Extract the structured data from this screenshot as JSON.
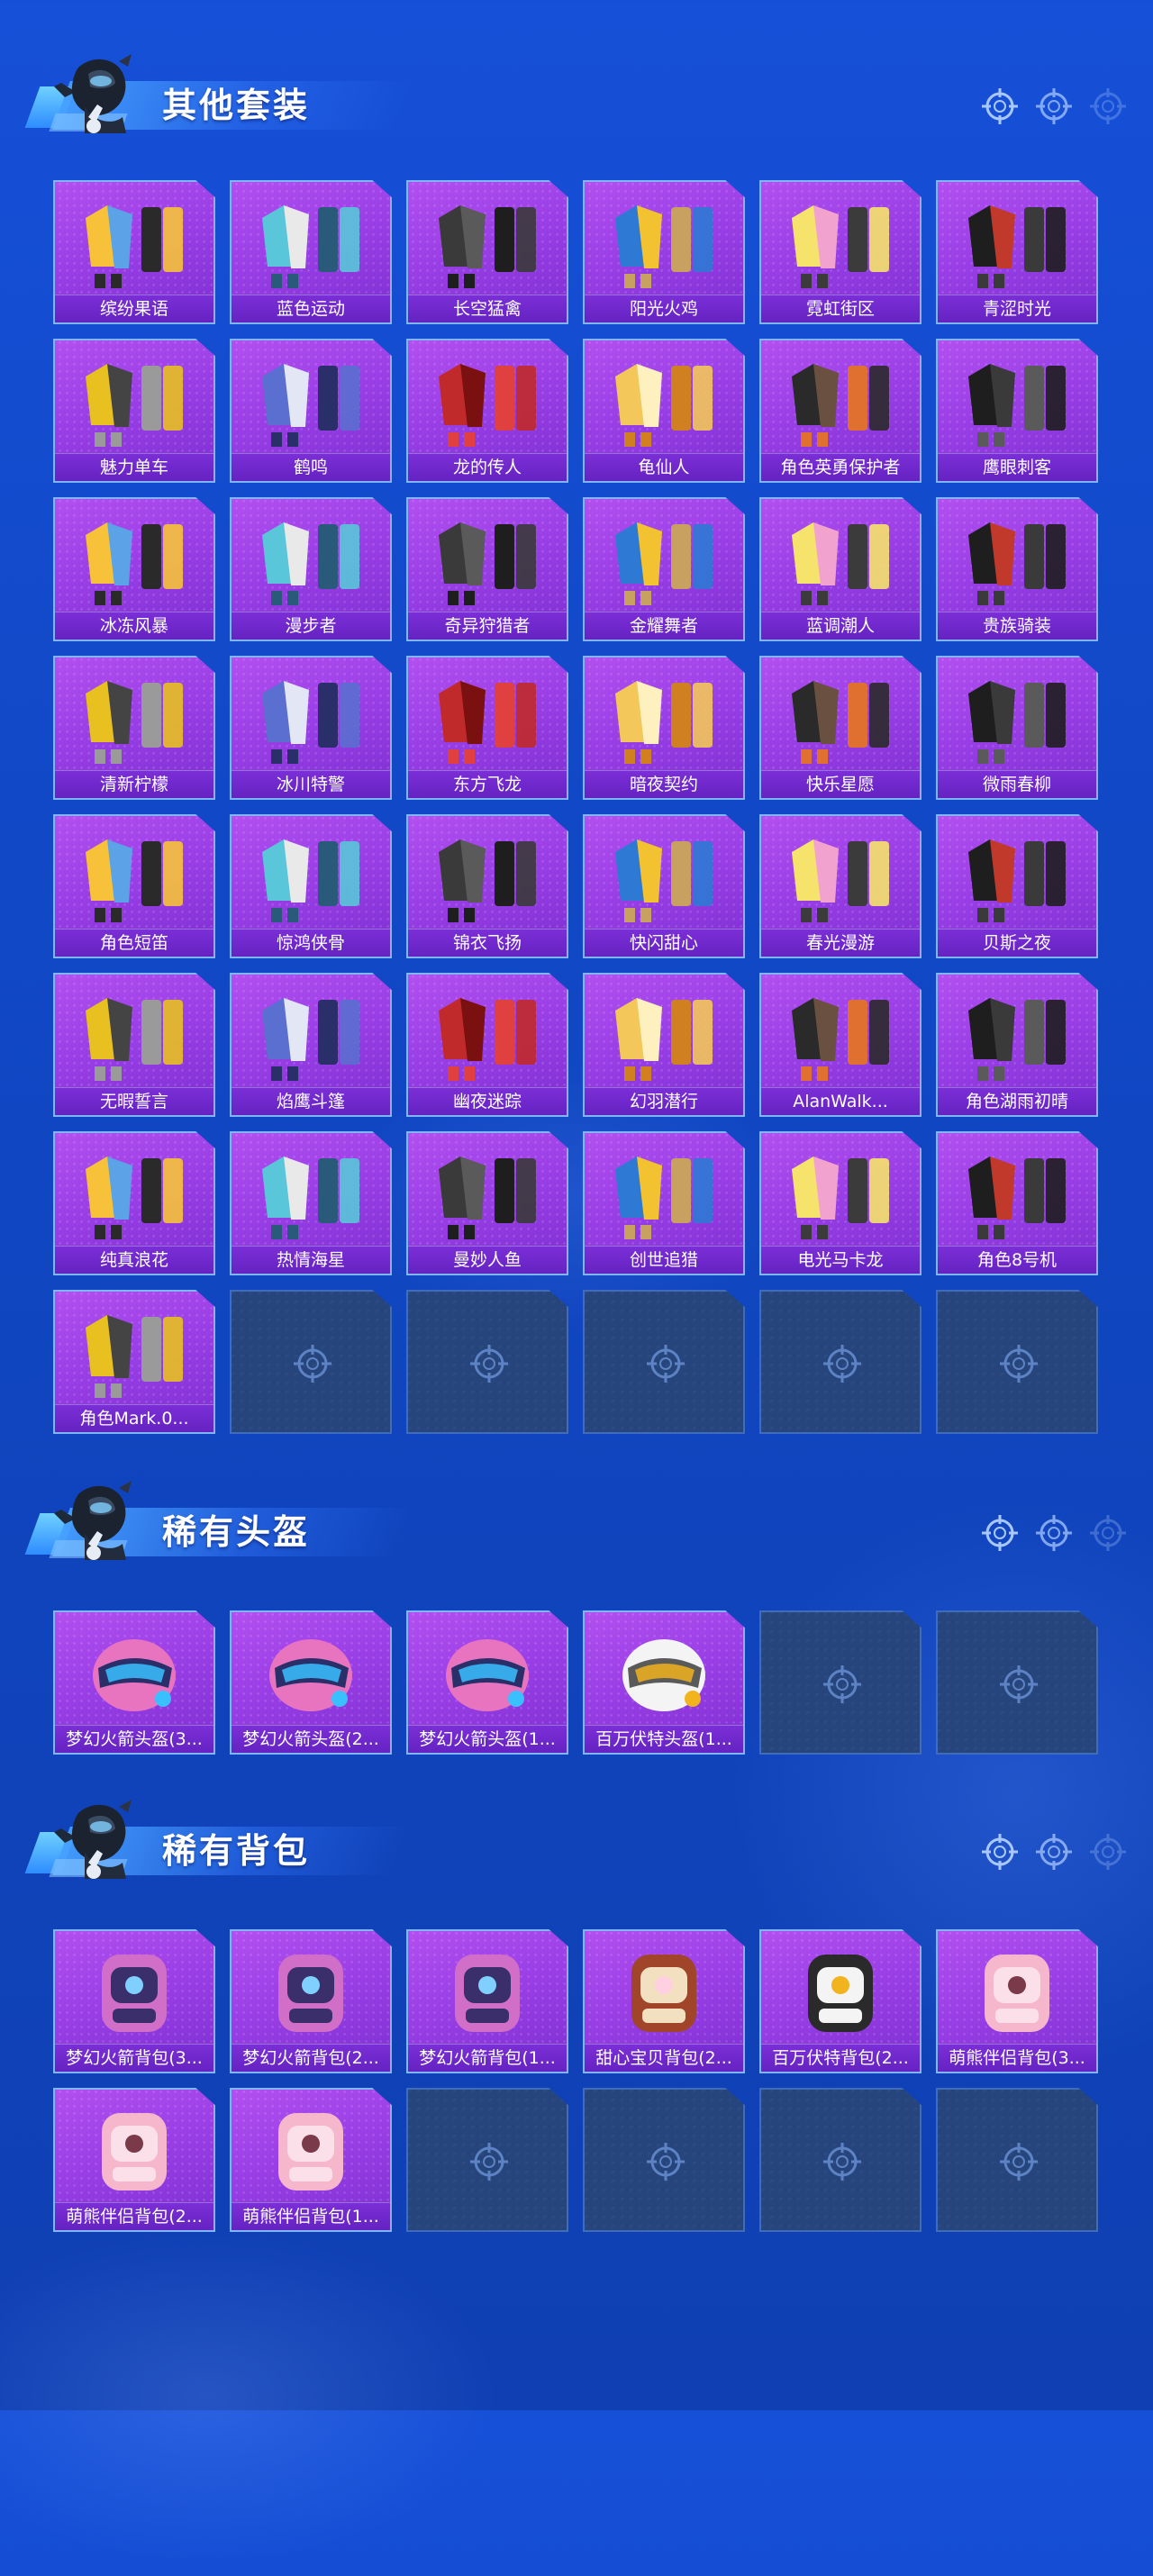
{
  "colors": {
    "background": "#1148c6",
    "card_purple": "#9a3fe6",
    "card_label": "#6522c2",
    "card_border": "#7fb6ff",
    "empty_card": "#26457c"
  },
  "sections": [
    {
      "title": "其他套装",
      "items": [
        "缤纷果语",
        "蓝色运动",
        "长空猛禽",
        "阳光火鸡",
        "霓虹街区",
        "青涩时光",
        "魅力单车",
        "鹤鸣",
        "龙的传人",
        "龟仙人",
        "角色英勇保护者",
        "鹰眼刺客",
        "冰冻风暴",
        "漫步者",
        "奇异狩猎者",
        "金耀舞者",
        "蓝调潮人",
        "贵族骑装",
        "清新柠檬",
        "冰川特警",
        "东方飞龙",
        "暗夜契约",
        "快乐星愿",
        "微雨春柳",
        "角色短笛",
        "惊鸿侠骨",
        "锦衣飞扬",
        "快闪甜心",
        "春光漫游",
        "贝斯之夜",
        "无暇誓言",
        "焰鹰斗篷",
        "幽夜迷踪",
        "幻羽潜行",
        "AlanWalk...",
        "角色湖雨初晴",
        "纯真浪花",
        "热情海星",
        "曼妙人鱼",
        "创世追猎",
        "电光马卡龙",
        "角色8号机",
        "角色Mark.0..."
      ],
      "empty_slots": 5
    },
    {
      "title": "稀有头盔",
      "items": [
        "梦幻火箭头盔(3...",
        "梦幻火箭头盔(2...",
        "梦幻火箭头盔(1...",
        "百万伏特头盔(1..."
      ],
      "empty_slots": 2
    },
    {
      "title": "稀有背包",
      "items": [
        "梦幻火箭背包(3...",
        "梦幻火箭背包(2...",
        "梦幻火箭背包(1...",
        "甜心宝贝背包(2...",
        "百万伏特背包(2...",
        "萌熊伴侣背包(3...",
        "萌熊伴侣背包(2...",
        "萌熊伴侣背包(1..."
      ],
      "empty_slots": 4
    }
  ]
}
